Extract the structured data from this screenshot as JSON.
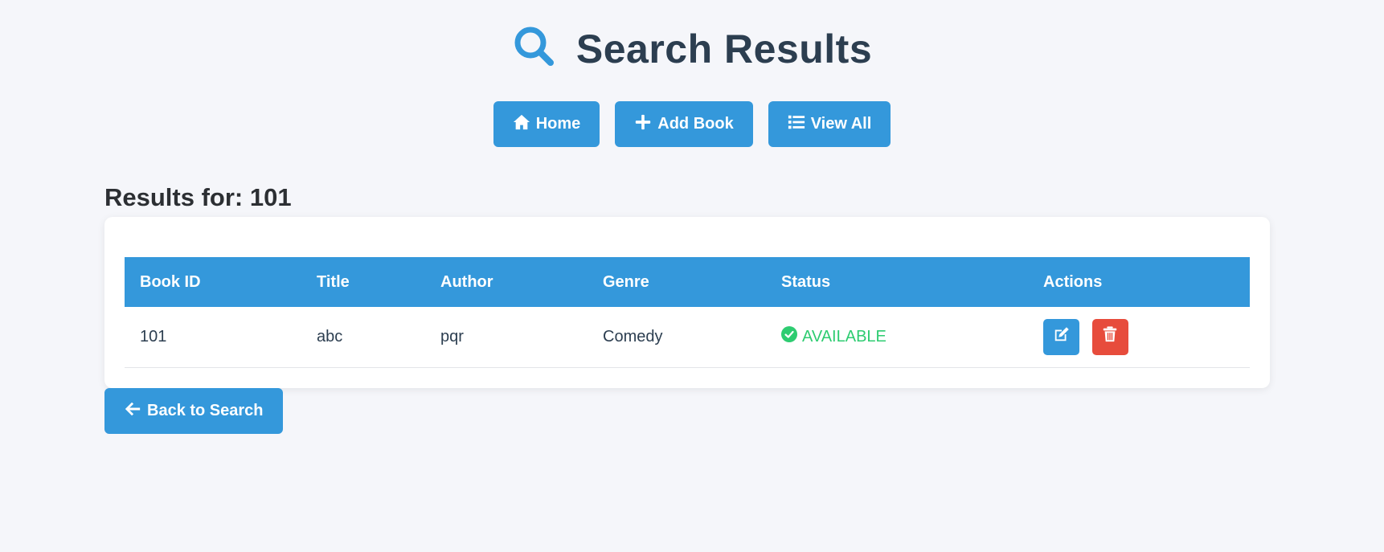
{
  "page": {
    "title": "Search Results",
    "icon": "search-icon",
    "accent_color": "#3498db",
    "title_color": "#2c3e50"
  },
  "nav": {
    "home_label": "Home",
    "add_book_label": "Add Book",
    "view_all_label": "View All"
  },
  "results": {
    "heading": "Results for: 101",
    "columns": [
      "Book ID",
      "Title",
      "Author",
      "Genre",
      "Status",
      "Actions"
    ],
    "rows": [
      {
        "book_id": "101",
        "title": "abc",
        "author": "pqr",
        "genre": "Comedy",
        "status": "AVAILABLE",
        "status_color": "#2ecc71"
      }
    ]
  },
  "actions": {
    "edit_icon": "edit-icon",
    "delete_icon": "trash-icon",
    "delete_color": "#e74c3c"
  },
  "back": {
    "label": "Back to Search"
  }
}
